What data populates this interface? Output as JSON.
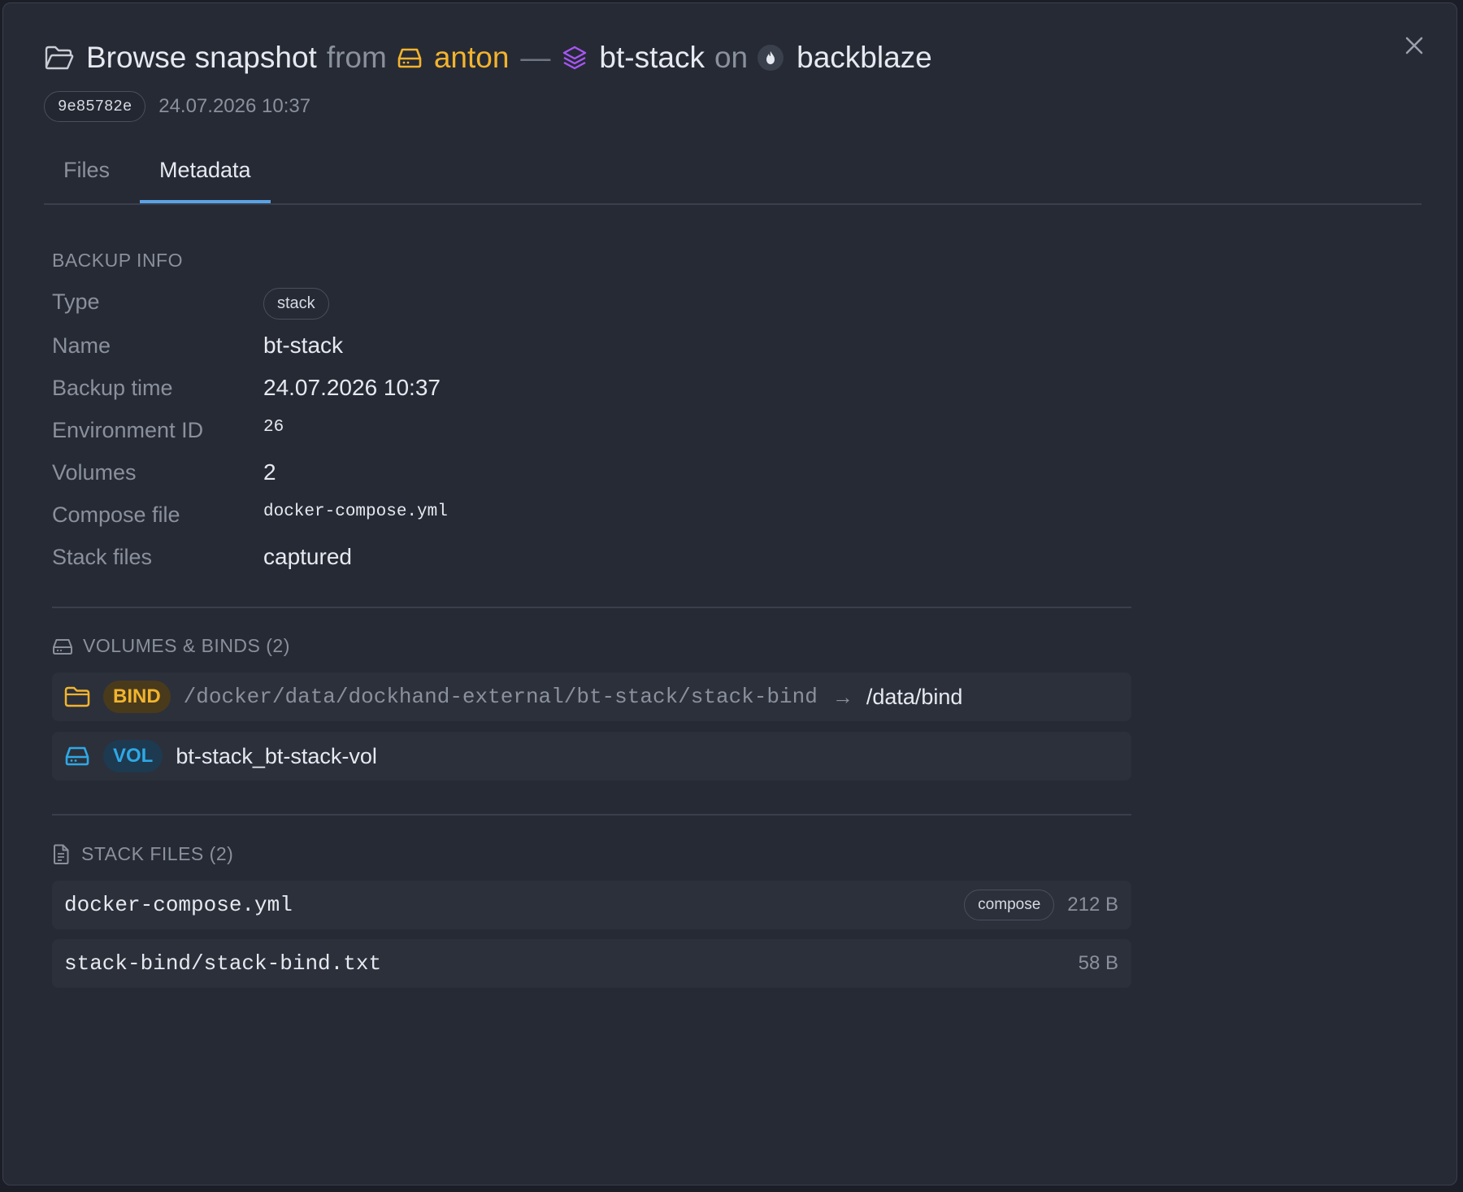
{
  "header": {
    "title": "Browse snapshot",
    "from": "from",
    "env": "anton",
    "dash": "—",
    "stack": "bt-stack",
    "on": "on",
    "target": "backblaze",
    "hash": "9e85782e",
    "date": "24.07.2026 10:37"
  },
  "tabs": [
    {
      "label": "Files"
    },
    {
      "label": "Metadata"
    }
  ],
  "backup_info": {
    "title": "BACKUP INFO",
    "rows": [
      {
        "label": "Type",
        "value": "stack"
      },
      {
        "label": "Name",
        "value": "bt-stack"
      },
      {
        "label": "Backup time",
        "value": "24.07.2026 10:37"
      },
      {
        "label": "Environment ID",
        "value": "26"
      },
      {
        "label": "Volumes",
        "value": "2"
      },
      {
        "label": "Compose file",
        "value": "docker-compose.yml"
      },
      {
        "label": "Stack files",
        "value": "captured"
      }
    ]
  },
  "volumes": {
    "title": "VOLUMES & BINDS (2)",
    "items": [
      {
        "badge": "BIND",
        "source": "/docker/data/dockhand-external/bt-stack/stack-bind",
        "arrow": "→",
        "dest": "/data/bind"
      },
      {
        "badge": "VOL",
        "name": "bt-stack_bt-stack-vol"
      }
    ]
  },
  "stack_files": {
    "title": "STACK FILES (2)",
    "items": [
      {
        "name": "docker-compose.yml",
        "tag": "compose",
        "size": "212 B"
      },
      {
        "name": "stack-bind/stack-bind.txt",
        "size": "58 B"
      }
    ]
  },
  "colors": {
    "accent": "#5aa2e6",
    "env": "#f2b42e",
    "stack": "#a855f7",
    "bind": "#f2b42e",
    "vol": "#2fa8e6"
  }
}
